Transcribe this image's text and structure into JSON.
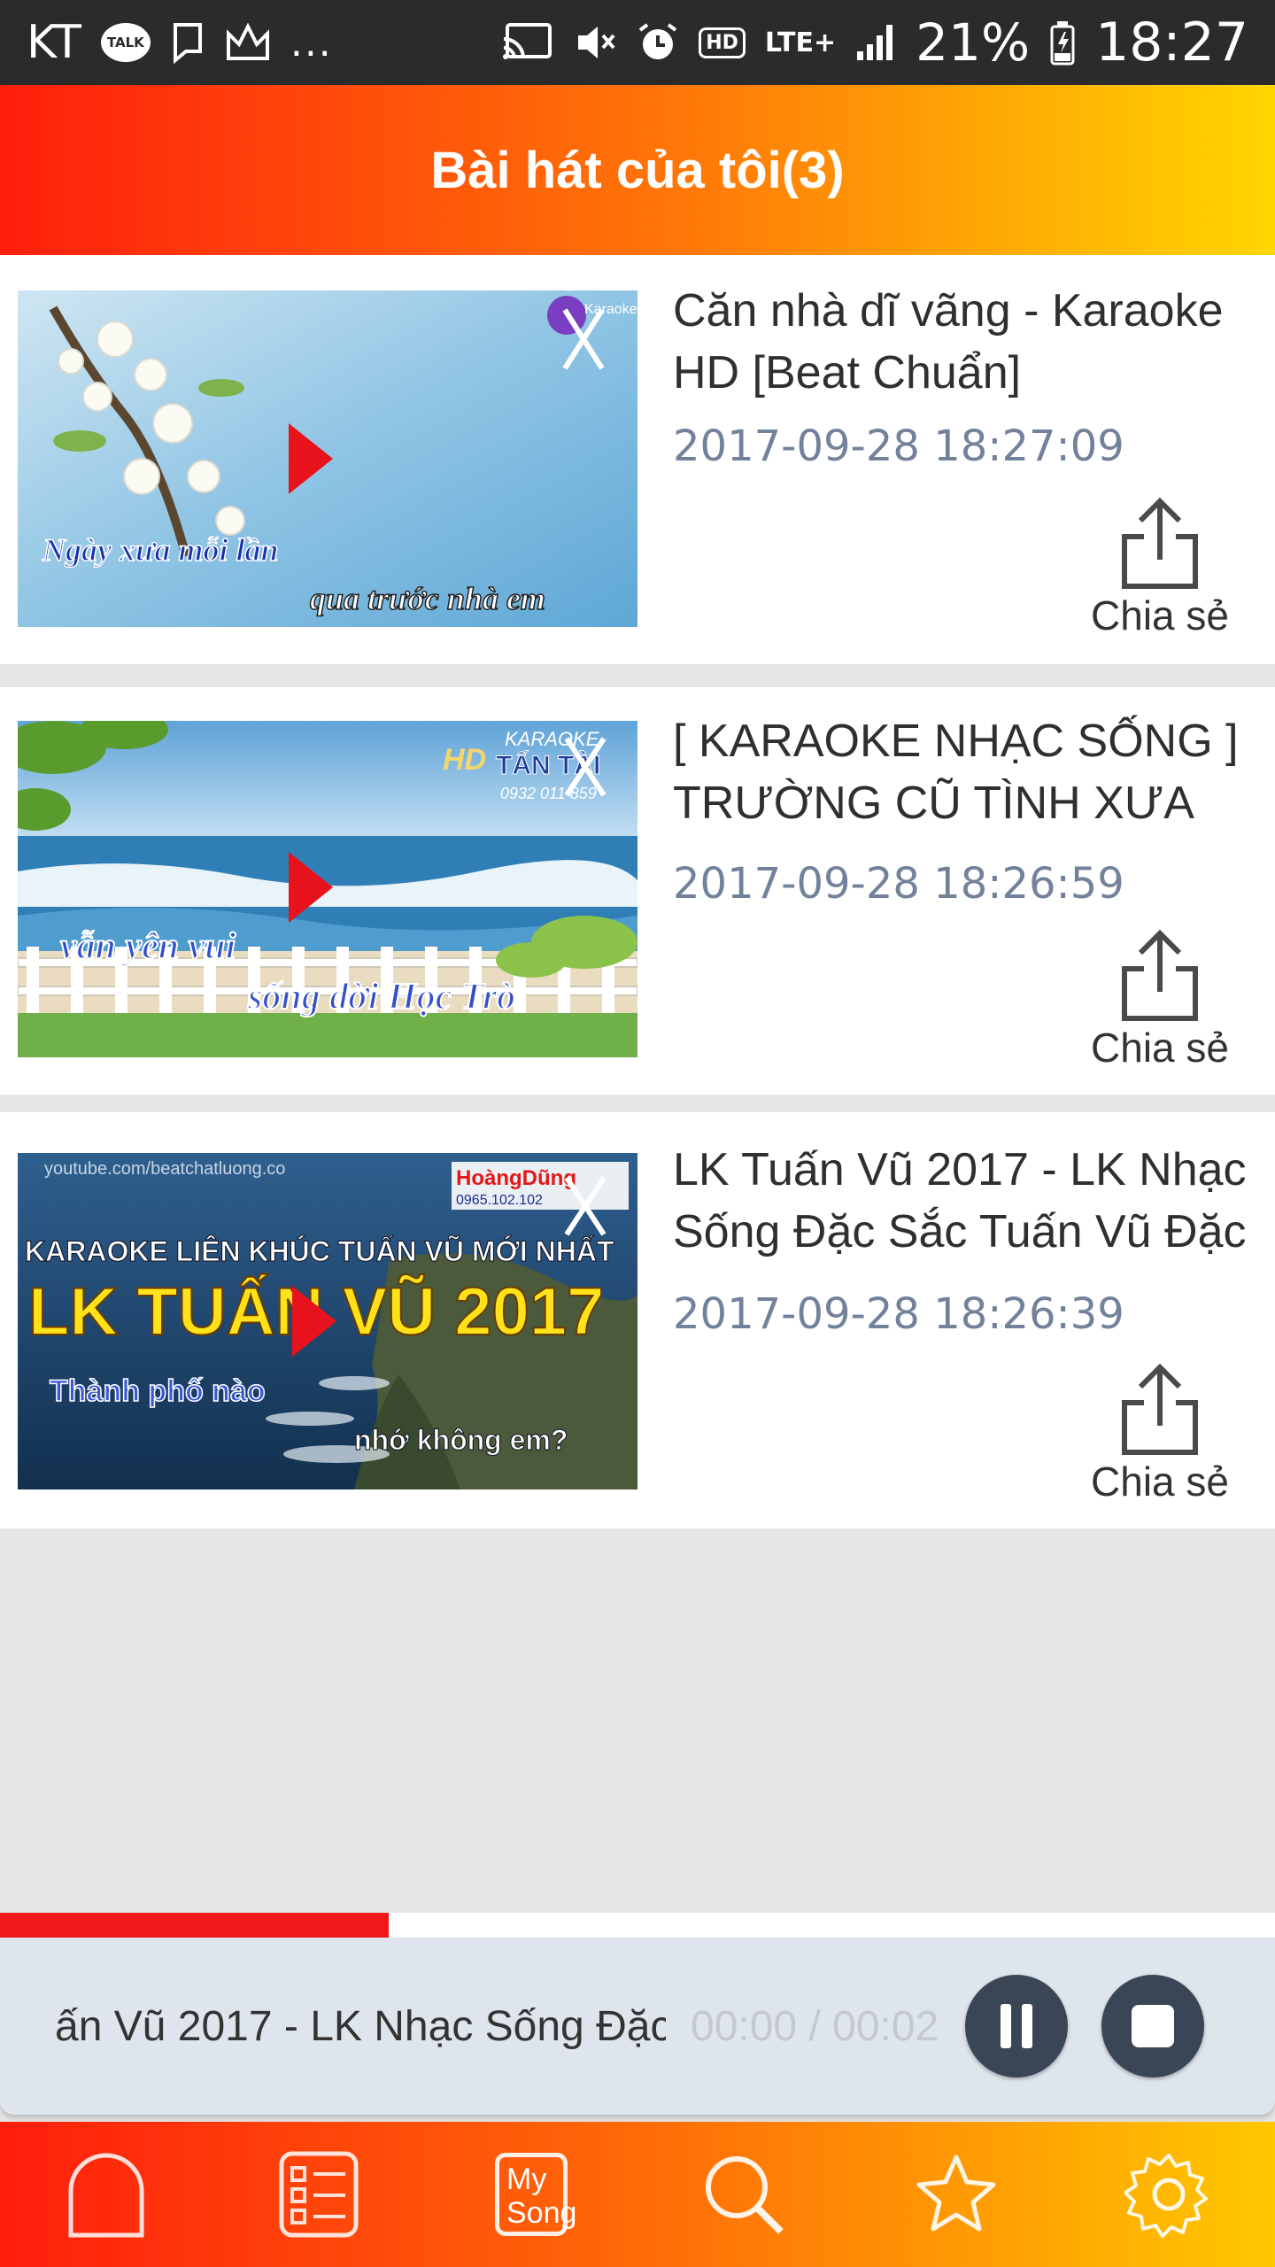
{
  "status_bar": {
    "carrier": "KT",
    "talk_icon_text": "TALK",
    "more": "...",
    "hd": "HD",
    "lte": "LTE+",
    "battery": "21%",
    "time": "18:27"
  },
  "header": {
    "title": "Bài hát của tôi(3)"
  },
  "songs": [
    {
      "title": "Căn nhà dĩ vãng - Karaoke HD [Beat Chuẩn]",
      "date": "2017-09-28 18:27:09",
      "share_label": "Chia sẻ",
      "thumb": {
        "line1": "Ngày xưa mỗi lần",
        "line2": "qua trước nhà em",
        "logo": "Karaoke"
      }
    },
    {
      "title": "[ KARAOKE NHẠC SỐNG ] TRƯỜNG CŨ TÌNH XƯA",
      "date": "2017-09-28 18:26:59",
      "share_label": "Chia sẻ",
      "thumb": {
        "line1": "vẫn yên vui",
        "line2": "sống đời Học Trò",
        "logo": "KARAOKE",
        "logo_name": "TẤN TÀI",
        "logo_hd": "HD",
        "phone": "0932 011 859"
      }
    },
    {
      "title": "LK Tuấn Vũ 2017 - LK Nhạc Sống Đặc Sắc Tuấn Vũ Đặc",
      "date": "2017-09-28 18:26:39",
      "share_label": "Chia sẻ",
      "thumb": {
        "url": "youtube.com/beatchatluong.co",
        "banner": "KARAOKE LIÊN KHÚC TUẤN VŨ MỚI NHẤT",
        "big": "LK TUẤN VŨ 2017",
        "line1": "Thành phố nào",
        "line2": "nhớ không em?",
        "logo": "HoàngDũng",
        "phone": "0965.102.102"
      }
    }
  ],
  "player": {
    "now_playing": "ấn Vũ 2017 - LK Nhạc Sống Đặc",
    "time": "00:00 / 00:02",
    "progress": 0.305
  },
  "nav": {
    "mysong_line1": "My",
    "mysong_line2": "Song",
    "items": [
      "home-icon",
      "list-icon",
      "my-song-icon",
      "search-icon",
      "star-icon",
      "settings-icon"
    ]
  },
  "colors": {
    "accent_start": "#ff1e0c",
    "accent_end": "#ffd600",
    "date_text": "#73829b",
    "progress": "#f01818",
    "play_arrow": "#e8121c"
  }
}
